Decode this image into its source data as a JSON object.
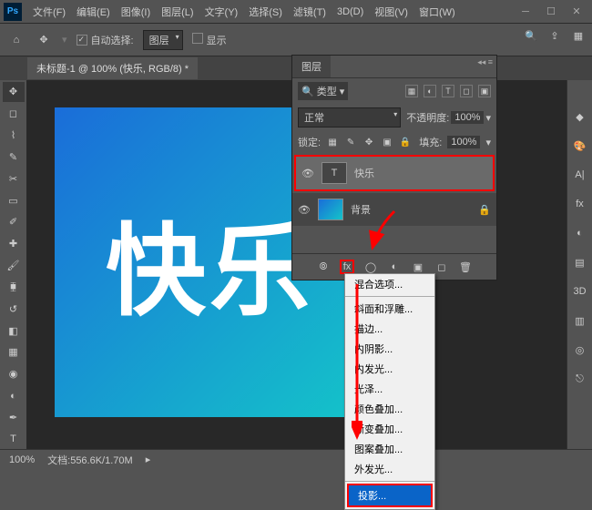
{
  "menubar": {
    "items": [
      "文件(F)",
      "编辑(E)",
      "图像(I)",
      "图层(L)",
      "文字(Y)",
      "选择(S)",
      "滤镜(T)",
      "3D(D)",
      "视图(V)",
      "窗口(W)"
    ]
  },
  "optbar": {
    "auto_select": "自动选择:",
    "target": "图层",
    "show": "显示"
  },
  "doc_tab": "未标题-1 @ 100% (快乐, RGB/8) *",
  "canvas_text": "快乐",
  "panel": {
    "title": "图层",
    "search_type": "类型",
    "blend": "正常",
    "opacity_label": "不透明度:",
    "opacity_val": "100%",
    "lock_label": "锁定:",
    "fill_label": "填充:",
    "fill_val": "100%",
    "layers": [
      {
        "name": "快乐",
        "type": "text"
      },
      {
        "name": "背景",
        "type": "bg"
      }
    ]
  },
  "fx_menu": {
    "items": [
      "混合选项...",
      "斜面和浮雕...",
      "描边...",
      "内阴影...",
      "内发光...",
      "光泽...",
      "颜色叠加...",
      "渐变叠加...",
      "图案叠加...",
      "外发光..."
    ],
    "highlighted": "投影..."
  },
  "status": {
    "zoom": "100%",
    "doc": "文档:556.6K/1.70M"
  }
}
